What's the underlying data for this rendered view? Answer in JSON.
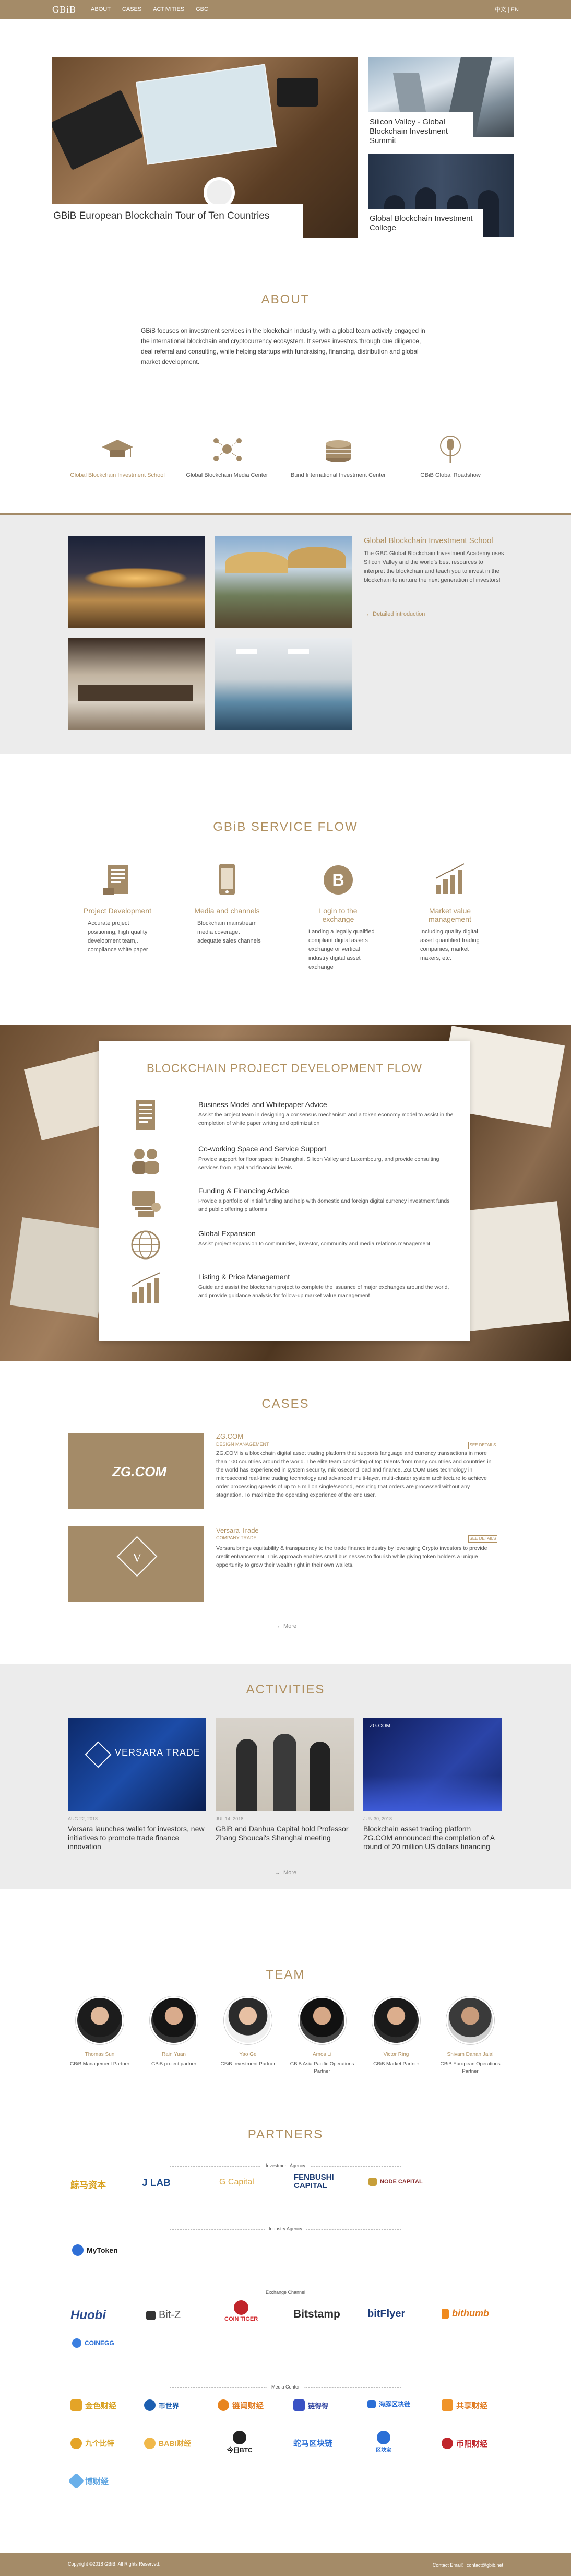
{
  "nav": {
    "logo": "GBiB",
    "items": [
      "ABOUT",
      "CASES",
      "ACTIVITIES",
      "GBC"
    ],
    "lang": "中文 | EN"
  },
  "hero": {
    "main_caption": "GBiB European Blockchain Tour of Ten Countries",
    "side1_caption": "Silicon Valley - Global Blockchain Investment Summit",
    "side2_caption": "Global Blockchain Investment College"
  },
  "about": {
    "title": "ABOUT",
    "text": "GBiB focuses on investment services in the blockchain industry, with a global team actively engaged in the international blockchain and cryptocurrency ecosystem. It serves investors through due diligence, deal referral and consulting, while helping startups with fundraising, financing, distribution and global market development.",
    "features": [
      {
        "label": "Global Blockchain Investment School",
        "icon": "graduation-cap-icon"
      },
      {
        "label": "Global Blockchain Media Center",
        "icon": "network-icon"
      },
      {
        "label": "Bund International Investment Center",
        "icon": "coins-icon"
      },
      {
        "label": "GBiB Global Roadshow",
        "icon": "microphone-icon"
      }
    ]
  },
  "school": {
    "title": "Global Blockchain Investment School",
    "desc": "The GBC Global Blockchain Investment Academy uses Silicon Valley and the world's best resources to interpret the blockchain and teach you to invest in the blockchain to nurture the next generation of investors!",
    "link": "Detailed introduction"
  },
  "service": {
    "title": "GBiB SERVICE FLOW",
    "items": [
      {
        "title": "Project Development",
        "desc": "Accurate project positioning, high quality development team,、compliance white paper",
        "icon": "document-icon"
      },
      {
        "title": "Media and channels",
        "desc": "Blockchain mainstream media coverage、adequate sales channels",
        "icon": "mobile-icon"
      },
      {
        "title": "Login to the exchange",
        "desc": "Landing a legally qualified compliant digital assets exchange or vertical industry digital asset exchange",
        "icon": "bitcoin-icon"
      },
      {
        "title": "Market value management",
        "desc": "Including quality digital asset quantified trading companies, market makers, etc.",
        "icon": "bar-chart-icon"
      }
    ]
  },
  "devflow": {
    "title": "BLOCKCHAIN PROJECT DEVELOPMENT FLOW",
    "steps": [
      {
        "title": "Business Model and Whitepaper Advice",
        "desc": "Assist the project team in designing a consensus mechanism and a token economy model to assist in the completion of white paper writing and optimization",
        "icon": "document-icon"
      },
      {
        "title": "Co-working Space and Service Support",
        "desc": "Provide support for floor space in Shanghai, Silicon Valley and Luxembourg, and provide consulting services from legal and financial levels",
        "icon": "people-icon"
      },
      {
        "title": "Funding & Financing Advice",
        "desc": "Provide a portfolio of initial funding and help with domestic and foreign digital currency investment funds and public offering platforms",
        "icon": "funding-icon"
      },
      {
        "title": "Global Expansion",
        "desc": "Assist project expansion to communities, investor, community and media relations management",
        "icon": "globe-icon"
      },
      {
        "title": "Listing & Price Management",
        "desc": "Guide and assist the blockchain project to complete the issuance of major exchanges around the world, and provide guidance analysis for follow-up market value management",
        "icon": "bar-chart-icon"
      }
    ]
  },
  "cases": {
    "title": "CASES",
    "items": [
      {
        "name": "ZG.COM",
        "sub": "DESIGN MANAGEMENT",
        "logo": "ZG.COM",
        "btn": "SEE DETAILS",
        "desc": "ZG.COM is a blockchain digital asset trading platform that supports language and currency transactions in more than 100 countries around the world. The elite team consisting of top talents from many countries and countries in the world has experienced in system security, microsecond load and finance. ZG.COM uses technology in microsecond real-time trading technology and advanced multi-layer, multi-cluster system architecture to achieve order processing speeds of up to 5 million single/second, ensuring that orders are processed without any stagnation. To maximize the operating experience of the end user."
      },
      {
        "name": "Versara Trade",
        "sub": "COMPANY TRADE",
        "logo": "V",
        "btn": "SEE DETAILS",
        "desc": "Versara brings equitability & transparency to the trade finance industry by leveraging Crypto investors to provide credit enhancement. This approach enables small businesses to flourish while giving token holders a unique opportunity to grow their wealth right in their own wallets."
      }
    ],
    "more": "More"
  },
  "activities": {
    "title": "ACTIVITIES",
    "items": [
      {
        "date": "AUG 22, 2018",
        "title": "Versara launches wallet for investors, new initiatives to promote trade finance innovation",
        "img_text": "VERSARA TRADE"
      },
      {
        "date": "JUL 14, 2018",
        "title": "GBiB and Danhua Capital hold Professor Zhang Shoucai's Shanghai meeting",
        "img_text": ""
      },
      {
        "date": "JUN 30, 2018",
        "title": "Blockchain asset trading platform ZG.COM announced the completion of A round of 20 million US dollars financing",
        "img_text": "ZG.COM"
      }
    ],
    "more": "More"
  },
  "team": {
    "title": "TEAM",
    "members": [
      {
        "name": "Thomas Sun",
        "role": "GBiB Management Partner"
      },
      {
        "name": "Rain Yuan",
        "role": "GBiB project partner"
      },
      {
        "name": "Yao Ge",
        "role": "GBiB Investment Partner"
      },
      {
        "name": "Amos Li",
        "role": "GBiB Asia Pacific Operations Partner"
      },
      {
        "name": "Victor Ring",
        "role": "GBiB Market Partner"
      },
      {
        "name": "Shivam Danan Jalal",
        "role": "GBiB European Operations Partner"
      }
    ]
  },
  "partners": {
    "title": "PARTNERS",
    "categories": [
      "Investment Agency",
      "Industry Agency",
      "Exchange Channel",
      "Media Center"
    ],
    "investment": [
      "鲸马资本",
      "J LAB",
      "G Capital",
      "FENBUSHI CAPITAL",
      "NODE CAPITAL"
    ],
    "industry": [
      "MyToken"
    ],
    "exchange": [
      "Huobi",
      "Bit-Z",
      "COIN TIGER",
      "Bitstamp",
      "bitFlyer",
      "bithumb",
      "COINEGG"
    ],
    "media": [
      "金色财经",
      "币世界",
      "链闻财经",
      "链得得",
      "海豚区块链",
      "共享财经",
      "九个比特",
      "BABI财经",
      "今日BTC",
      "蛇马区块链",
      "区块宝",
      "币阳财经",
      "博财经"
    ]
  },
  "footer": {
    "copyright": "Copyright ©2018 GBiB. All Rights Reserved.",
    "contact": "Contact Email：contact@gbib.net"
  }
}
